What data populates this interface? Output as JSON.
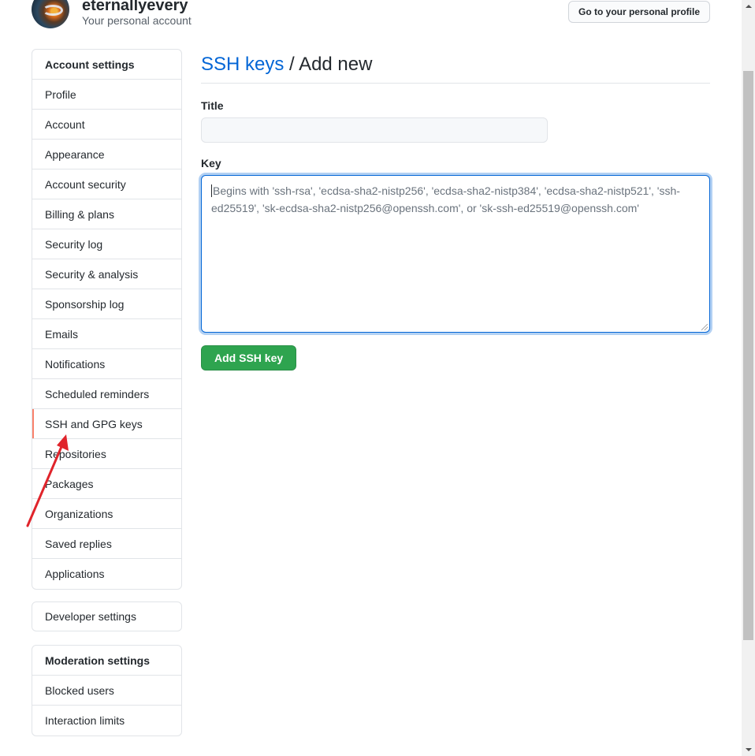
{
  "header": {
    "username": "eternallyevery",
    "account_type": "Your personal account",
    "profile_button": "Go to your personal profile"
  },
  "sidebar": {
    "account_settings": {
      "heading": "Account settings",
      "items": [
        {
          "label": "Profile"
        },
        {
          "label": "Account"
        },
        {
          "label": "Appearance"
        },
        {
          "label": "Account security"
        },
        {
          "label": "Billing & plans"
        },
        {
          "label": "Security log"
        },
        {
          "label": "Security & analysis"
        },
        {
          "label": "Sponsorship log"
        },
        {
          "label": "Emails"
        },
        {
          "label": "Notifications"
        },
        {
          "label": "Scheduled reminders"
        },
        {
          "label": "SSH and GPG keys",
          "selected": true
        },
        {
          "label": "Repositories"
        },
        {
          "label": "Packages"
        },
        {
          "label": "Organizations"
        },
        {
          "label": "Saved replies"
        },
        {
          "label": "Applications"
        }
      ]
    },
    "developer_settings": {
      "label": "Developer settings"
    },
    "moderation_settings": {
      "heading": "Moderation settings",
      "items": [
        {
          "label": "Blocked users"
        },
        {
          "label": "Interaction limits"
        }
      ]
    }
  },
  "main": {
    "breadcrumb_link": "SSH keys",
    "breadcrumb_separator": " / ",
    "page_title": "Add new",
    "title_label": "Title",
    "title_value": "",
    "key_label": "Key",
    "key_placeholder": "Begins with 'ssh-rsa', 'ecdsa-sha2-nistp256', 'ecdsa-sha2-nistp384', 'ecdsa-sha2-nistp521', 'ssh-ed25519', 'sk-ecdsa-sha2-nistp256@openssh.com', or 'sk-ssh-ed25519@openssh.com'",
    "submit_button": "Add SSH key"
  },
  "colors": {
    "link": "#0366d6",
    "primary_button": "#2ea44f",
    "selected_indicator": "#f9826c",
    "annotation_arrow": "#e0242b"
  },
  "icons": [
    "avatar",
    "resize-grip-icon",
    "scroll-up-arrow-icon",
    "scroll-down-arrow-icon",
    "annotation-arrow"
  ]
}
